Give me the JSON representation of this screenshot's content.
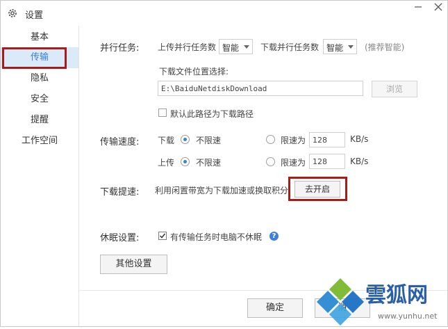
{
  "window": {
    "title": "设置"
  },
  "sidebar": {
    "items": [
      {
        "label": "基本"
      },
      {
        "label": "传输"
      },
      {
        "label": "隐私"
      },
      {
        "label": "安全"
      },
      {
        "label": "提醒"
      },
      {
        "label": "工作空间"
      }
    ],
    "active_index": 1
  },
  "parallel": {
    "label": "并行任务:",
    "upload_label": "上传并行任务数",
    "upload_value": "智能",
    "download_label": "下载并行任务数",
    "download_value": "智能",
    "hint": "(推荐智能)"
  },
  "download_location": {
    "label": "下载文件位置选择:",
    "path": "E:\\BaiduNetdiskDownload",
    "browse": "浏览",
    "default_checkbox": "默认此路径为下载路径",
    "default_checked": false
  },
  "speed": {
    "label": "传输速度:",
    "download_label": "下载",
    "upload_label": "上传",
    "unlimited": "不限速",
    "limit": "限速为",
    "download_limit": "128",
    "upload_limit": "128",
    "unit": "KB/s"
  },
  "boost": {
    "label": "下载提速:",
    "text": "利用闲置带宽为下载加速或换取积分",
    "button": "去开启"
  },
  "sleep": {
    "label": "休眠设置:",
    "checkbox": "有传输任务时电脑不休眠",
    "checked": true,
    "help_glyph": "?"
  },
  "other_button": "其他设置",
  "footer": {
    "ok": "确定",
    "cancel": "消"
  },
  "watermark": {
    "brand": "雲狐网",
    "url": "www.yunhu.net"
  },
  "colors": {
    "accent": "#3b82d6",
    "highlight_box": "#a81b1b",
    "active_bg": "#dbeaf9"
  }
}
